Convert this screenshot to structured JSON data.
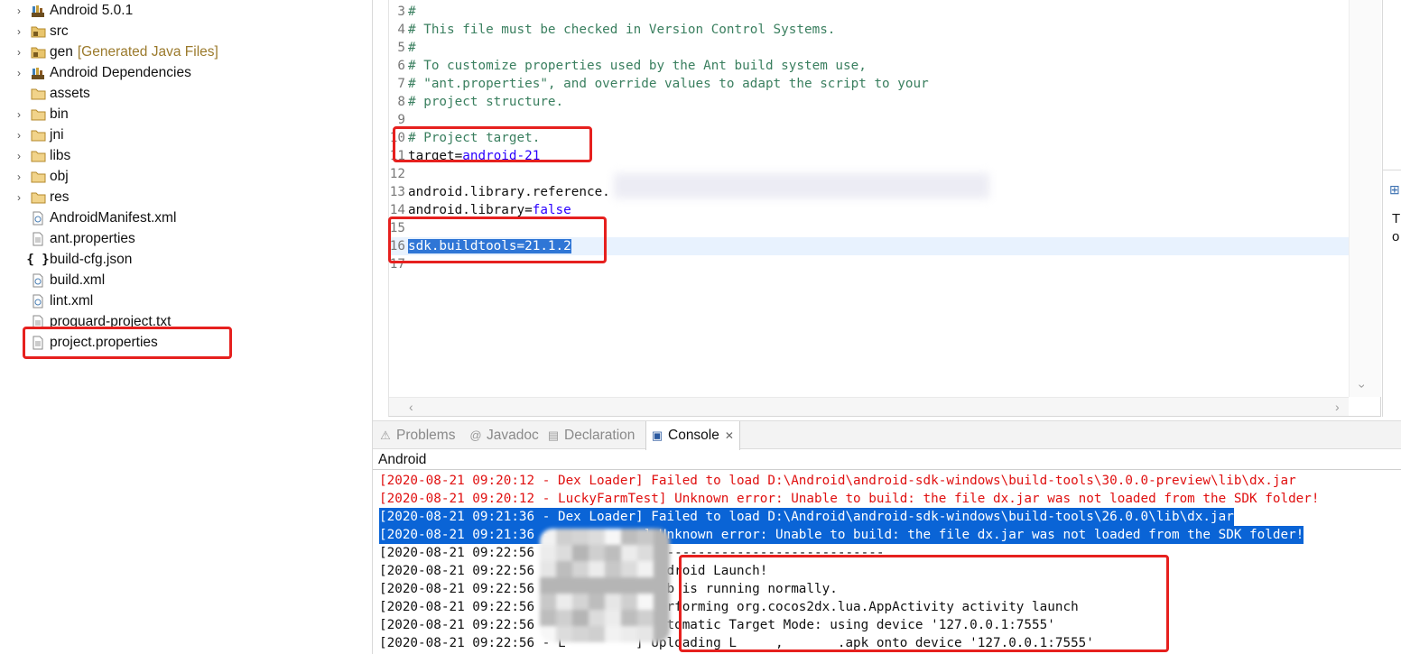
{
  "explorer": {
    "items": [
      {
        "label": "Android 5.0.1",
        "icon": "android-library-icon",
        "arrow": true,
        "decoration": ""
      },
      {
        "label": "src",
        "icon": "source-folder-icon",
        "arrow": true,
        "decoration": ""
      },
      {
        "label": "gen",
        "icon": "source-folder-icon",
        "arrow": true,
        "decoration": "[Generated Java Files]"
      },
      {
        "label": "Android Dependencies",
        "icon": "android-library-icon",
        "arrow": true,
        "decoration": ""
      },
      {
        "label": "assets",
        "icon": "folder-icon",
        "arrow": false,
        "decoration": ""
      },
      {
        "label": "bin",
        "icon": "folder-icon",
        "arrow": true,
        "decoration": ""
      },
      {
        "label": "jni",
        "icon": "folder-icon",
        "arrow": true,
        "decoration": ""
      },
      {
        "label": "libs",
        "icon": "folder-icon",
        "arrow": true,
        "decoration": ""
      },
      {
        "label": "obj",
        "icon": "folder-icon",
        "arrow": true,
        "decoration": ""
      },
      {
        "label": "res",
        "icon": "folder-icon",
        "arrow": true,
        "decoration": ""
      },
      {
        "label": "AndroidManifest.xml",
        "icon": "xml-file-icon",
        "arrow": false,
        "decoration": ""
      },
      {
        "label": "ant.properties",
        "icon": "text-file-icon",
        "arrow": false,
        "decoration": ""
      },
      {
        "label": "build-cfg.json",
        "icon": "json-file-icon",
        "arrow": false,
        "decoration": ""
      },
      {
        "label": "build.xml",
        "icon": "xml-file-icon",
        "arrow": false,
        "decoration": ""
      },
      {
        "label": "lint.xml",
        "icon": "xml-file-icon",
        "arrow": false,
        "decoration": ""
      },
      {
        "label": "proguard-project.txt",
        "icon": "text-file-icon",
        "arrow": false,
        "decoration": ""
      },
      {
        "label": "project.properties",
        "icon": "text-file-icon",
        "arrow": false,
        "decoration": ""
      }
    ]
  },
  "editor": {
    "lines": [
      {
        "n": "3",
        "parts": [
          {
            "t": "#",
            "c": "cmt"
          }
        ]
      },
      {
        "n": "4",
        "parts": [
          {
            "t": "# This file must be checked in Version Control Systems.",
            "c": "cmt"
          }
        ]
      },
      {
        "n": "5",
        "parts": [
          {
            "t": "#",
            "c": "cmt"
          }
        ]
      },
      {
        "n": "6",
        "parts": [
          {
            "t": "# To customize properties used by the Ant build system use,",
            "c": "cmt"
          }
        ]
      },
      {
        "n": "7",
        "parts": [
          {
            "t": "# \"ant.properties\", and override values to adapt the script to your",
            "c": "cmt"
          }
        ]
      },
      {
        "n": "8",
        "parts": [
          {
            "t": "# project structure.",
            "c": "cmt"
          }
        ]
      },
      {
        "n": "9",
        "parts": []
      },
      {
        "n": "10",
        "parts": [
          {
            "t": "# Project target.",
            "c": "cmt"
          }
        ]
      },
      {
        "n": "11",
        "parts": [
          {
            "t": "target=",
            "c": "key"
          },
          {
            "t": "android-21",
            "c": "val"
          }
        ]
      },
      {
        "n": "12",
        "parts": []
      },
      {
        "n": "13",
        "parts": [
          {
            "t": "android.library.reference.",
            "c": "key"
          }
        ]
      },
      {
        "n": "14",
        "parts": [
          {
            "t": "android.library=",
            "c": "key"
          },
          {
            "t": "false",
            "c": "val"
          }
        ]
      },
      {
        "n": "15",
        "parts": []
      },
      {
        "n": "16",
        "parts": [
          {
            "t": "sdk.buildtools=21.1.2",
            "c": "sel"
          }
        ]
      },
      {
        "n": "17",
        "parts": []
      }
    ]
  },
  "right_panel": {
    "icon": "outline-view-icon",
    "text": "T o"
  },
  "console": {
    "tabs": [
      {
        "label": "Problems",
        "icon": "problems-icon",
        "active": false
      },
      {
        "label": "Javadoc",
        "icon": "javadoc-icon",
        "active": false
      },
      {
        "label": "Declaration",
        "icon": "declaration-icon",
        "active": false
      },
      {
        "label": "Console",
        "icon": "console-icon",
        "active": true
      }
    ],
    "title": "Android",
    "lines": [
      {
        "text": "[2020-08-21 09:20:12 - Dex Loader] Failed to load D:\\Android\\android-sdk-windows\\build-tools\\30.0.0-preview\\lib\\dx.jar",
        "c": "con-red"
      },
      {
        "text": "[2020-08-21 09:20:12 - LuckyFarmTest] Unknown error: Unable to build: the file dx.jar was not loaded from the SDK folder!",
        "c": "con-red"
      },
      {
        "text": "[2020-08-21 09:21:36 - Dex Loader] Failed to load D:\\Android\\android-sdk-windows\\build-tools\\26.0.0\\lib\\dx.jar",
        "c": "con-sel"
      },
      {
        "text": "[2020-08-21 09:21:36 -            ] Unknown error: Unable to build: the file dx.jar was not loaded from the SDK folder!",
        "c": "con-sel"
      },
      {
        "text": "[2020-08-21 09:22:56             ] ------------------------------",
        "c": "con-black"
      },
      {
        "text": "[2020-08-21 09:22:56             ] Android Launch!",
        "c": "con-black"
      },
      {
        "text": "[2020-08-21 09:22:56             ] adb is running normally.",
        "c": "con-black"
      },
      {
        "text": "[2020-08-21 09:22:56 -           ] Performing org.cocos2dx.lua.AppActivity activity launch",
        "c": "con-black"
      },
      {
        "text": "[2020-08-21 09:22:56 -           ] Automatic Target Mode: using device '127.0.0.1:7555'",
        "c": "con-black"
      },
      {
        "text": "[2020-08-21 09:22:56 - L         ] Uploading L     ,       .apk onto device '127.0.0.1:7555'",
        "c": "con-black"
      }
    ]
  },
  "colors": {
    "annotation_red": "#e6201e",
    "console_error_red": "#e01010",
    "selection_blue": "#0a64d6",
    "comment_green": "#3a7f5f",
    "value_blue": "#2a00ff"
  }
}
